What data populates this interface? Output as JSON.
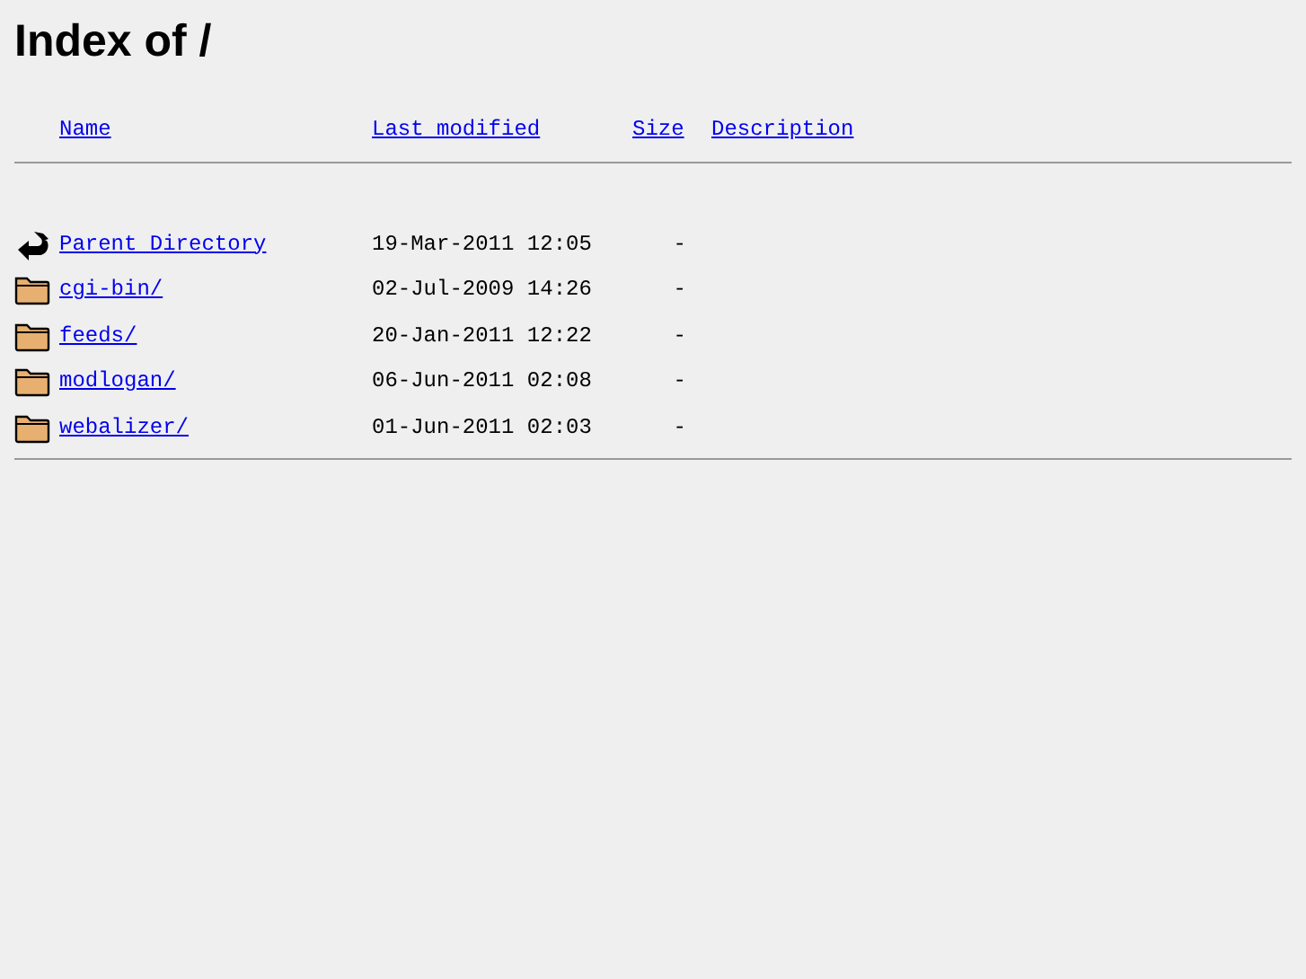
{
  "title": "Index of /",
  "columns": [
    "Name",
    "Last modified",
    "Size",
    "Description"
  ],
  "rows": [
    {
      "kind": "parent",
      "name": "Parent Directory",
      "modified": "19-Mar-2011 12:05",
      "size": "-"
    },
    {
      "kind": "folder",
      "name": "cgi-bin/",
      "modified": "02-Jul-2009 14:26",
      "size": "-"
    },
    {
      "kind": "folder",
      "name": "feeds/",
      "modified": "20-Jan-2011 12:22",
      "size": "-"
    },
    {
      "kind": "folder",
      "name": "modlogan/",
      "modified": "06-Jun-2011 02:08",
      "size": "-"
    },
    {
      "kind": "folder",
      "name": "webalizer/",
      "modified": "01-Jun-2011 02:03",
      "size": "-"
    }
  ]
}
